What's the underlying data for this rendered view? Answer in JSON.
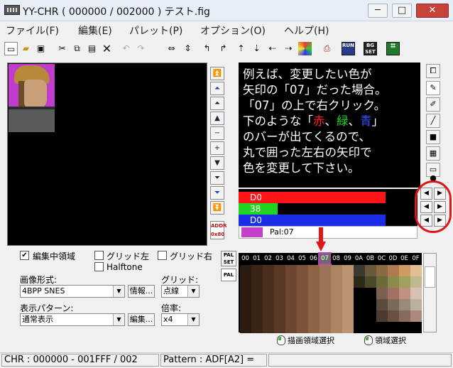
{
  "window": {
    "title": "YY-CHR ( 000000 / 002000 ) テスト.fig",
    "minimize": "─",
    "maximize": "□",
    "close": "✕"
  },
  "menu": {
    "items": [
      "ファイル(F)",
      "編集(E)",
      "パレット(P)",
      "オプション(O)",
      "ヘルプ(H)"
    ]
  },
  "toolbar": {
    "icons": [
      "new-icon",
      "open-icon",
      "save-icon",
      "cut-icon",
      "copy-icon",
      "paste-icon",
      "delete-icon",
      "undo-icon",
      "redo-icon",
      "flip-h-icon",
      "flip-v-icon",
      "rotate-left-icon",
      "rotate-right-icon",
      "shift-up-icon",
      "shift-down-icon",
      "shift-left-icon",
      "shift-right-icon",
      "palette-icon",
      "export-icon",
      "run-icon",
      "bgset-icon",
      "settings-icon"
    ],
    "run_label": "RUN",
    "bg_label": "BG SET"
  },
  "instruction": {
    "line1": "例えば、変更したい色が",
    "line2": "矢印の「07」だった場合。",
    "line3": "「07」の上で右クリック。",
    "line4_pre": "下のような「",
    "red": "赤",
    "sep1": "、",
    "green": "緑",
    "sep2": "、",
    "blue": "青",
    "line4_post": "」",
    "line5": "のバーが出てくるので、",
    "line6": "丸で囲った左右の矢印で",
    "line7": "色を変更して下さい。"
  },
  "color_bars": {
    "red_value": "D0",
    "green_value": "38",
    "blue_value": "D0",
    "pal_label": "Pal:07",
    "red_fraction": 0.82,
    "green_fraction": 0.22,
    "blue_fraction": 0.82
  },
  "palette": {
    "headers": [
      "00",
      "01",
      "02",
      "03",
      "04",
      "05",
      "06",
      "07",
      "08",
      "09",
      "0A",
      "0B",
      "0C",
      "0D",
      "0E",
      "0F"
    ],
    "selected_index": 7,
    "set_label": "PAL SET",
    "pal_label": "PAL"
  },
  "controls": {
    "edit_area": "編集中領域",
    "grid_left": "グリッド左",
    "grid_right": "グリッド右",
    "halftone": "Halftone",
    "image_format_label": "画像形式:",
    "image_format_value": "4BPP SNES",
    "info_button": "情報...",
    "grid_label": "グリッド:",
    "grid_value": "点線",
    "display_pattern_label": "表示パターン:",
    "display_pattern_value": "通常表示",
    "edit_button": "編集...",
    "zoom_label": "倍率:",
    "zoom_value": "x4",
    "draw_area_select": "描画領域選択",
    "area_select": "領域選択"
  },
  "address": {
    "label": "ADDR",
    "value": "0x80"
  },
  "status": {
    "chr": "CHR : 000000 - 001FFF / 002",
    "pattern": "Pattern : ADF[A2] ="
  },
  "colors": {
    "red": "#ff1515",
    "green": "#22d422",
    "blue": "#1a2ee8",
    "selected_pal": "#c53fcb"
  }
}
